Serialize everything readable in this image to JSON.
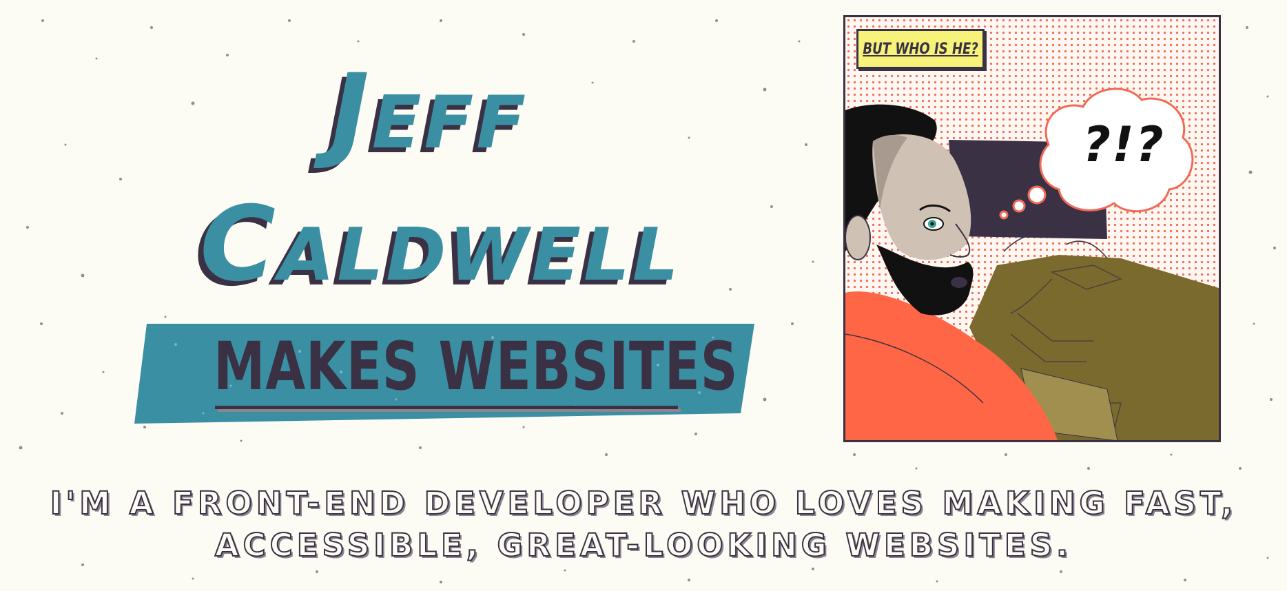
{
  "hero": {
    "first_name": "Jeff",
    "last_name": "Caldwell",
    "makes": "MAKES WEBSITES"
  },
  "comic": {
    "caption": "BUT WHO IS HE?",
    "thought": "?!?"
  },
  "tagline": {
    "line1": "I'M A FRONT-END DEVELOPER WHO LOVES MAKING FAST,",
    "line2": "ACCESSIBLE, GREAT-LOOKING WEBSITES."
  },
  "colors": {
    "background": "#fdfcf4",
    "teal": "#3b8fa3",
    "ink": "#3a3144",
    "halftone": "#f26a55",
    "caption_yellow": "#f6f27a",
    "shirt": "#ff6645",
    "desk": "#7a6a2e"
  }
}
